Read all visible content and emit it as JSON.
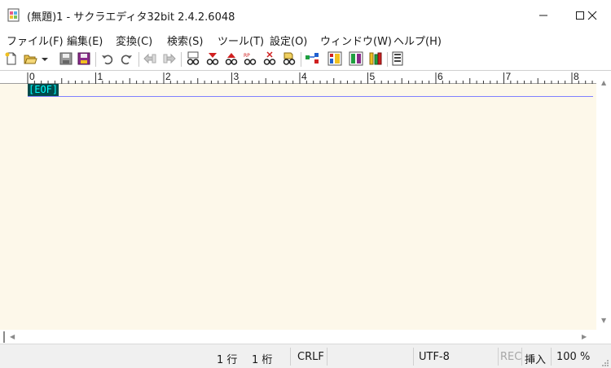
{
  "window": {
    "title": "(無題)1 - サクラエディタ32bit 2.4.2.6048",
    "controls": [
      "minimize",
      "maximize",
      "close"
    ]
  },
  "menu": {
    "items": [
      {
        "label": "ファイル(F)"
      },
      {
        "label": "編集(E)"
      },
      {
        "label": "変換(C)"
      },
      {
        "label": "検索(S)"
      },
      {
        "label": "ツール(T)"
      },
      {
        "label": "設定(O)"
      },
      {
        "label": "ウィンドウ(W)"
      },
      {
        "label": "ヘルプ(H)"
      }
    ]
  },
  "toolbar": {
    "buttons": [
      "new-file-icon",
      "open-folder-icon",
      "dropdown-arrow-icon",
      "save-icon",
      "save-all-icon",
      "undo-icon",
      "redo-icon",
      "back-icon",
      "forward-icon",
      "search-icon",
      "search-next-down-icon",
      "search-prev-up-icon",
      "replace-icon",
      "clear-mark-icon",
      "grep-icon",
      "jump-icon",
      "outline-icon",
      "compare-icon",
      "settings-icon",
      "type-settings-icon"
    ]
  },
  "ruler": {
    "labels": [
      "0",
      "1",
      "2",
      "3",
      "4",
      "5",
      "6",
      "7",
      "8"
    ]
  },
  "editor": {
    "eof_label": "[EOF]",
    "background_color": "#fdf8ea",
    "eof_fg_color": "#00ffff",
    "eof_bg_color": "#004b4b",
    "cursor_line_color": "#8080ff"
  },
  "statusbar": {
    "line": "1 行",
    "column": "1 桁",
    "eol": "CRLF",
    "encoding": "UTF-8",
    "rec": "REC",
    "mode": "挿入",
    "zoom": "100 %"
  }
}
